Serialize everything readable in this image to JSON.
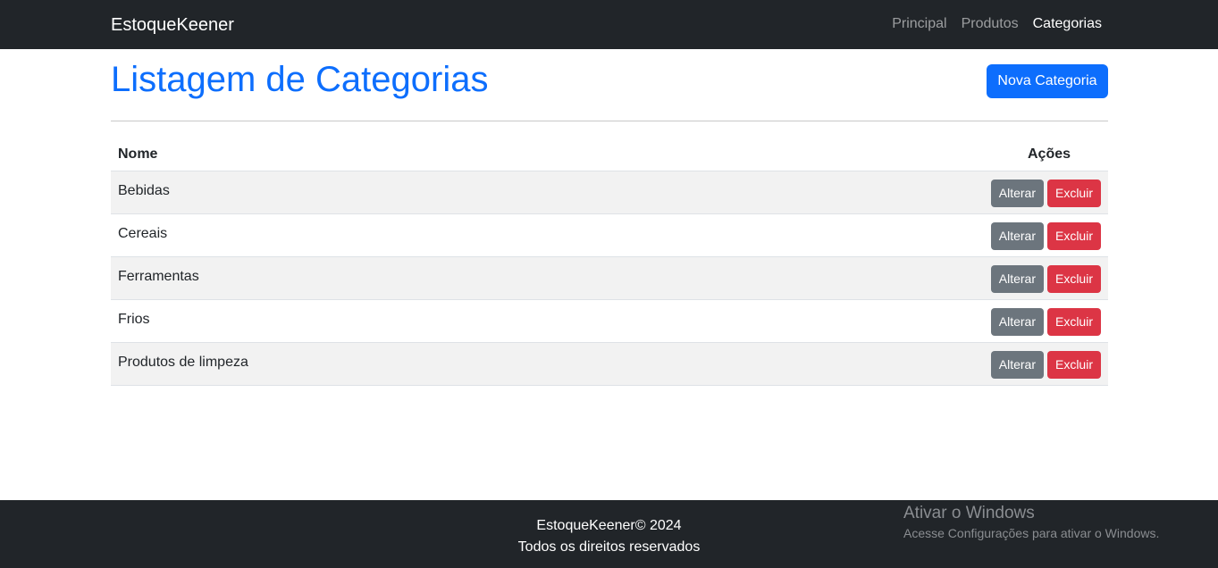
{
  "navbar": {
    "brand": "EstoqueKeener",
    "links": [
      {
        "label": "Principal"
      },
      {
        "label": "Produtos"
      },
      {
        "label": "Categorias"
      }
    ]
  },
  "main": {
    "title": "Listagem de Categorias",
    "new_button_label": "Nova Categoria",
    "table": {
      "headers": {
        "name": "Nome",
        "actions": "Ações"
      },
      "rows": [
        {
          "name": "Bebidas",
          "edit_label": "Alterar",
          "delete_label": "Excluir"
        },
        {
          "name": "Cereais",
          "edit_label": "Alterar",
          "delete_label": "Excluir"
        },
        {
          "name": "Ferramentas",
          "edit_label": "Alterar",
          "delete_label": "Excluir"
        },
        {
          "name": "Frios",
          "edit_label": "Alterar",
          "delete_label": "Excluir"
        },
        {
          "name": "Produtos de limpeza",
          "edit_label": "Alterar",
          "delete_label": "Excluir"
        }
      ]
    }
  },
  "footer": {
    "line1": "EstoqueKeener© 2024",
    "line2": "Todos os direitos reservados"
  },
  "windows_watermark": {
    "title": "Ativar o Windows",
    "subtitle": "Acesse Configurações para ativar o Windows."
  },
  "colors": {
    "primary": "#0d6efd",
    "secondary": "#6c757d",
    "danger": "#dc3545",
    "dark": "#212529"
  }
}
